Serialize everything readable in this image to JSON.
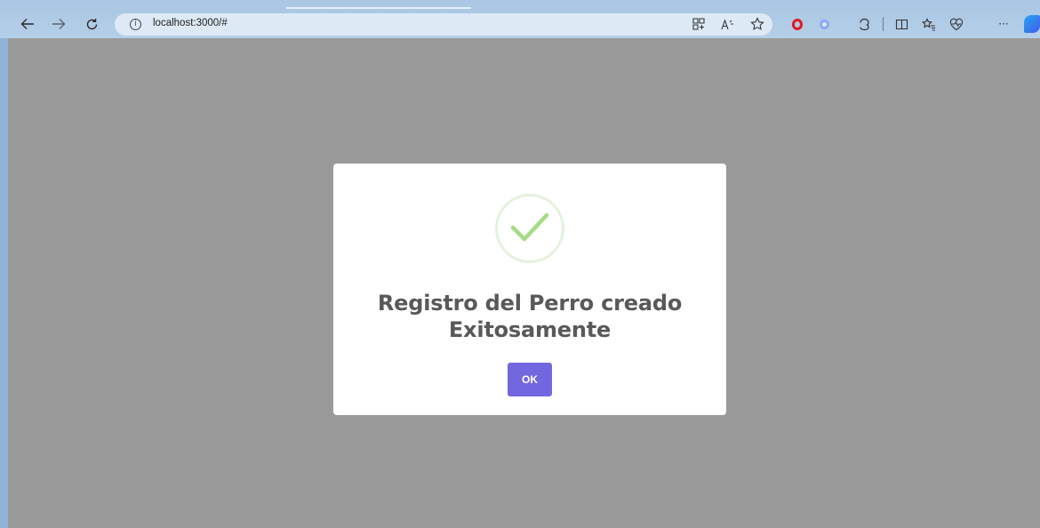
{
  "browser": {
    "url": "localhost:3000/#",
    "icons": {
      "back": "arrow-left-icon",
      "forward": "arrow-right-icon",
      "refresh": "refresh-icon",
      "site_info": "info-icon",
      "apps": "apps-icon",
      "read_aloud": "read-aloud-icon",
      "favorite": "star-icon",
      "opera": "opera-extension-icon",
      "lens": "lens-extension-icon",
      "extensions": "puzzle-icon",
      "split_screen": "split-screen-icon",
      "favorites": "favorites-icon",
      "performance": "heart-pulse-icon",
      "more": "more-icon",
      "copilot": "copilot-icon"
    },
    "glyphs": {
      "info": "i",
      "more": "···"
    }
  },
  "modal": {
    "title": "Registro del Perro creado Exitosamente",
    "ok_label": "OK",
    "icon": "checkmark-success-icon",
    "accent_color": "#7367e0",
    "success_color": "#a5dc86"
  }
}
